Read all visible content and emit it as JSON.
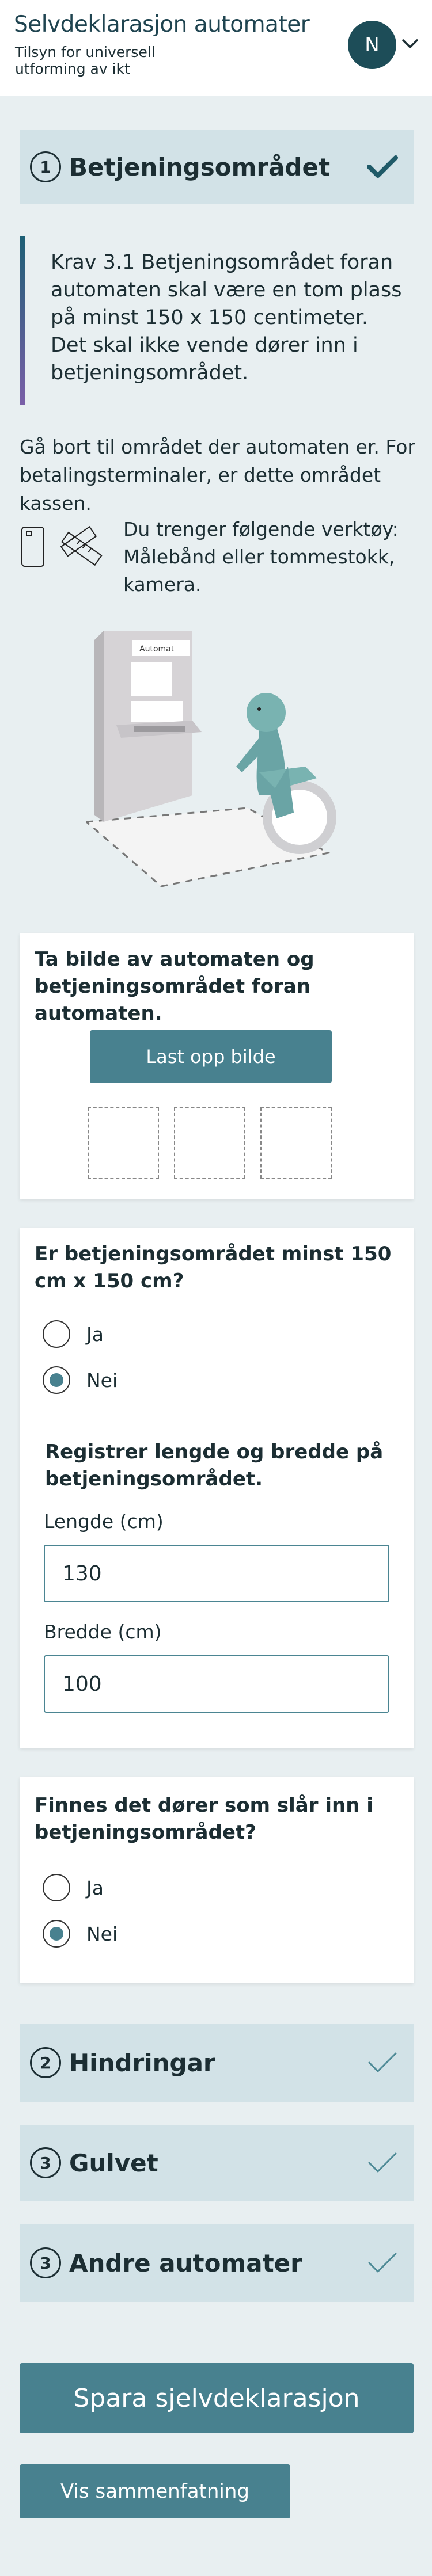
{
  "header": {
    "app_title": "Selvdeklarasjon automater",
    "subtitle": "Tilsyn for universell utforming av ikt",
    "avatar_initial": "N"
  },
  "sections": [
    {
      "number": "1",
      "title": "Betjeningsområdet",
      "status": "completed"
    },
    {
      "number": "2",
      "title": "Hindringar",
      "status": "outline"
    },
    {
      "number": "3",
      "title": "Gulvet",
      "status": "outline"
    },
    {
      "number": "3",
      "title": "Andre automater",
      "status": "outline"
    }
  ],
  "requirement": "Krav 3.1 Betjeningsområdet foran automaten skal være en tom plass på minst 150 x 150 centimeter. Det skal ikke vende dører inn i betjeningsområdet.",
  "intro": "Gå bort til området der automaten er. For betalingsterminaler, er dette området kassen.",
  "tools": "Du trenger følgende verktøy: Målebånd eller tommestokk, kamera.",
  "illustration": {
    "machine_label": "Automat"
  },
  "photo_card": {
    "title": "Ta bilde av automaten og betjeningsområdet foran automaten.",
    "upload_button": "Last opp bilde",
    "thumbnail_slots": 3
  },
  "size_card": {
    "question": "Er betjeningsområdet minst 150 cm x 150 cm?",
    "options": [
      "Ja",
      "Nei"
    ],
    "selected": "Nei",
    "register_title": "Registrer lengde og bredde på betjeningsområdet.",
    "length_label": "Lengde (cm)",
    "length_value": "130",
    "width_label": "Bredde (cm)",
    "width_value": "100"
  },
  "door_card": {
    "question": "Finnes det dører som slår inn i betjeningsområdet?",
    "options": [
      "Ja",
      "Nei"
    ],
    "selected": "Nei"
  },
  "actions": {
    "save": "Spara sjelvdeklarasjon",
    "summary": "Vis sammenfatning"
  },
  "colors": {
    "background": "#e8eff1",
    "section_bg": "#d2e2e7",
    "primary": "#48818f",
    "dark": "#1d4d58",
    "text": "#1c2e33"
  }
}
